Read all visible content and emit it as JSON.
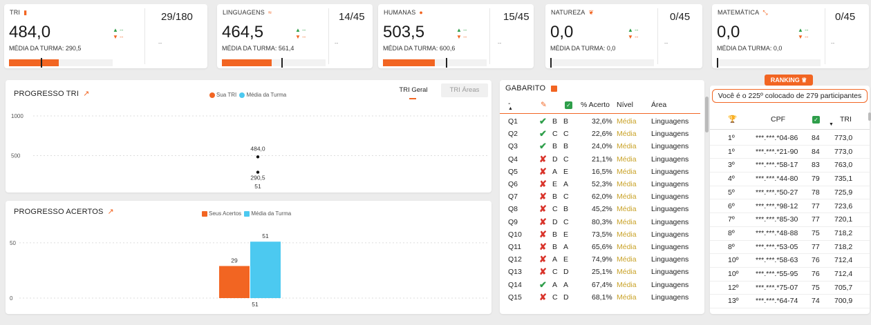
{
  "kpis": [
    {
      "title": "TRI",
      "icon": "bookmark-icon",
      "value": "484,0",
      "avg": "MÉDIA DA TURMA: 290,5",
      "up": "▲ --",
      "down": "▼ --",
      "count": "29/180",
      "dash": "--",
      "bar_fraction": 0.45,
      "mark_fraction": 0.29
    },
    {
      "title": "LINGUAGENS",
      "icon": "wifi-icon",
      "value": "464,5",
      "avg": "MÉDIA DA TURMA: 561,4",
      "up": "▲ --",
      "down": "▼ --",
      "count": "14/45",
      "dash": "--",
      "bar_fraction": 0.45,
      "mark_fraction": 0.54
    },
    {
      "title": "HUMANAS",
      "icon": "globe-icon",
      "value": "503,5",
      "avg": "MÉDIA DA TURMA: 600,6",
      "up": "▲ --",
      "down": "▼ --",
      "count": "15/45",
      "dash": "--",
      "bar_fraction": 0.47,
      "mark_fraction": 0.57
    },
    {
      "title": "NATUREZA",
      "icon": "leaf-icon",
      "value": "0,0",
      "avg": "MÉDIA DA TURMA: 0,0",
      "up": "▲ --",
      "down": "▼ --",
      "count": "0/45",
      "dash": "--",
      "bar_fraction": 0,
      "mark_fraction": 0
    },
    {
      "title": "MATEMÁTICA",
      "icon": "expand-icon",
      "value": "0,0",
      "avg": "MÉDIA DA TURMA: 0,0",
      "up": "▲ --",
      "down": "▼ --",
      "count": "0/45",
      "dash": "--",
      "bar_fraction": 0,
      "mark_fraction": 0
    }
  ],
  "progresso_tri": {
    "title": "PROGRESSO TRI",
    "legend": [
      "Sua TRI",
      "Média da Turma"
    ],
    "tabs": [
      "TRI Geral",
      "TRI Áreas"
    ],
    "chart_data": {
      "type": "scatter",
      "x": [
        "51"
      ],
      "series": [
        {
          "name": "Sua TRI",
          "values": [
            484.0
          ],
          "labels": [
            "484,0"
          ]
        },
        {
          "name": "Média da Turma",
          "values": [
            290.5
          ],
          "labels": [
            "290,5"
          ]
        }
      ],
      "yticks": [
        "1000",
        "500"
      ],
      "ylim": [
        0,
        1000
      ]
    }
  },
  "progresso_acertos": {
    "title": "PROGRESSO ACERTOS",
    "legend": [
      "Seus Acertos",
      "Média da Turma"
    ],
    "chart_data": {
      "type": "bar",
      "categories": [
        "51"
      ],
      "series": [
        {
          "name": "Seus Acertos",
          "values": [
            29
          ],
          "color": "#f26522"
        },
        {
          "name": "Média da Turma",
          "values": [
            51
          ],
          "color": "#4cc9f0"
        }
      ],
      "yticks": [
        "50",
        "0"
      ],
      "ylim": [
        0,
        58
      ]
    }
  },
  "gabarito": {
    "title": "GABARITO",
    "headers": {
      "q": "-",
      "pct": "% Acerto",
      "nivel": "Nível",
      "area": "Área"
    },
    "rows": [
      {
        "q": "Q1",
        "ok": true,
        "mark": "B",
        "key": "B",
        "pct": "32,6%",
        "nivel": "Média",
        "area": "Linguagens"
      },
      {
        "q": "Q2",
        "ok": true,
        "mark": "C",
        "key": "C",
        "pct": "22,6%",
        "nivel": "Média",
        "area": "Linguagens"
      },
      {
        "q": "Q3",
        "ok": true,
        "mark": "B",
        "key": "B",
        "pct": "24,0%",
        "nivel": "Média",
        "area": "Linguagens"
      },
      {
        "q": "Q4",
        "ok": false,
        "mark": "D",
        "key": "C",
        "pct": "21,1%",
        "nivel": "Média",
        "area": "Linguagens"
      },
      {
        "q": "Q5",
        "ok": false,
        "mark": "A",
        "key": "E",
        "pct": "16,5%",
        "nivel": "Média",
        "area": "Linguagens"
      },
      {
        "q": "Q6",
        "ok": false,
        "mark": "E",
        "key": "A",
        "pct": "52,3%",
        "nivel": "Média",
        "area": "Linguagens"
      },
      {
        "q": "Q7",
        "ok": false,
        "mark": "B",
        "key": "C",
        "pct": "62,0%",
        "nivel": "Média",
        "area": "Linguagens"
      },
      {
        "q": "Q8",
        "ok": false,
        "mark": "C",
        "key": "B",
        "pct": "45,2%",
        "nivel": "Média",
        "area": "Linguagens"
      },
      {
        "q": "Q9",
        "ok": false,
        "mark": "D",
        "key": "C",
        "pct": "80,3%",
        "nivel": "Média",
        "area": "Linguagens"
      },
      {
        "q": "Q10",
        "ok": false,
        "mark": "B",
        "key": "E",
        "pct": "73,5%",
        "nivel": "Média",
        "area": "Linguagens"
      },
      {
        "q": "Q11",
        "ok": false,
        "mark": "B",
        "key": "A",
        "pct": "65,6%",
        "nivel": "Média",
        "area": "Linguagens"
      },
      {
        "q": "Q12",
        "ok": false,
        "mark": "A",
        "key": "E",
        "pct": "74,9%",
        "nivel": "Média",
        "area": "Linguagens"
      },
      {
        "q": "Q13",
        "ok": false,
        "mark": "C",
        "key": "D",
        "pct": "25,1%",
        "nivel": "Média",
        "area": "Linguagens"
      },
      {
        "q": "Q14",
        "ok": true,
        "mark": "A",
        "key": "A",
        "pct": "67,4%",
        "nivel": "Média",
        "area": "Linguagens"
      },
      {
        "q": "Q15",
        "ok": false,
        "mark": "C",
        "key": "D",
        "pct": "68,1%",
        "nivel": "Média",
        "area": "Linguagens"
      }
    ]
  },
  "ranking": {
    "label": "RANKING",
    "banner": "Você é o 225º colocado de 279 participantes",
    "headers": {
      "cpf": "CPF",
      "tri": "TRI"
    },
    "rows": [
      {
        "pos": "1º",
        "cpf": "***.***.*04-86",
        "acertos": "84",
        "tri": "773,0"
      },
      {
        "pos": "1º",
        "cpf": "***.***.*21-90",
        "acertos": "84",
        "tri": "773,0"
      },
      {
        "pos": "3º",
        "cpf": "***.***.*58-17",
        "acertos": "83",
        "tri": "763,0"
      },
      {
        "pos": "4º",
        "cpf": "***.***.*44-80",
        "acertos": "79",
        "tri": "735,1"
      },
      {
        "pos": "5º",
        "cpf": "***.***.*50-27",
        "acertos": "78",
        "tri": "725,9"
      },
      {
        "pos": "6º",
        "cpf": "***.***.*98-12",
        "acertos": "77",
        "tri": "723,6"
      },
      {
        "pos": "7º",
        "cpf": "***.***.*85-30",
        "acertos": "77",
        "tri": "720,1"
      },
      {
        "pos": "8º",
        "cpf": "***.***.*48-88",
        "acertos": "75",
        "tri": "718,2"
      },
      {
        "pos": "8º",
        "cpf": "***.***.*53-05",
        "acertos": "77",
        "tri": "718,2"
      },
      {
        "pos": "10º",
        "cpf": "***.***.*58-63",
        "acertos": "76",
        "tri": "712,4"
      },
      {
        "pos": "10º",
        "cpf": "***.***.*55-95",
        "acertos": "76",
        "tri": "712,4"
      },
      {
        "pos": "12º",
        "cpf": "***.***.*75-07",
        "acertos": "75",
        "tri": "705,7"
      },
      {
        "pos": "13º",
        "cpf": "***.***.*64-74",
        "acertos": "74",
        "tri": "700,9"
      }
    ]
  }
}
